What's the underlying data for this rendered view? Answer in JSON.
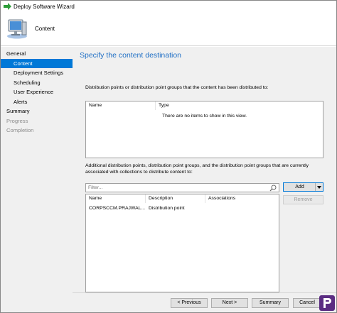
{
  "window": {
    "title": "Deploy Software Wizard"
  },
  "header": {
    "title": "Content"
  },
  "sidebar": {
    "items": [
      {
        "label": "General"
      },
      {
        "label": "Content"
      },
      {
        "label": "Deployment Settings"
      },
      {
        "label": "Scheduling"
      },
      {
        "label": "User Experience"
      },
      {
        "label": "Alerts"
      },
      {
        "label": "Summary"
      },
      {
        "label": "Progress"
      },
      {
        "label": "Completion"
      }
    ]
  },
  "main": {
    "section_title": "Specify the content destination",
    "distributed_label": "Distribution points or distribution point groups that the content has been distributed to:",
    "top_list": {
      "columns": [
        "Name",
        "Type"
      ],
      "empty_text": "There are no items to show in this view."
    },
    "additional_label": "Additional distribution points, distribution point groups, and the distribution point groups that are currently associated with collections to distribute content to:",
    "filter": {
      "placeholder": "Filter..."
    },
    "bottom_list": {
      "columns": [
        "Name",
        "Description",
        "Associations"
      ],
      "rows": [
        {
          "name": "CORPSCCM.PRAJWAL...",
          "description": "Distribution point",
          "associations": ""
        }
      ]
    },
    "add_button": "Add",
    "remove_button": "Remove"
  },
  "footer": {
    "previous": "< Previous",
    "next": "Next >",
    "summary": "Summary",
    "cancel": "Cancel"
  },
  "colors": {
    "accent": "#0078d7",
    "section_title": "#1f6fc5",
    "panel_bg": "#f0f0f0",
    "watermark": "#5b2d82"
  },
  "icons": [
    "wizard-arrow-icon",
    "computer-monitor-icon",
    "search-icon",
    "dropdown-arrow-icon",
    "brand-logo-icon"
  ]
}
